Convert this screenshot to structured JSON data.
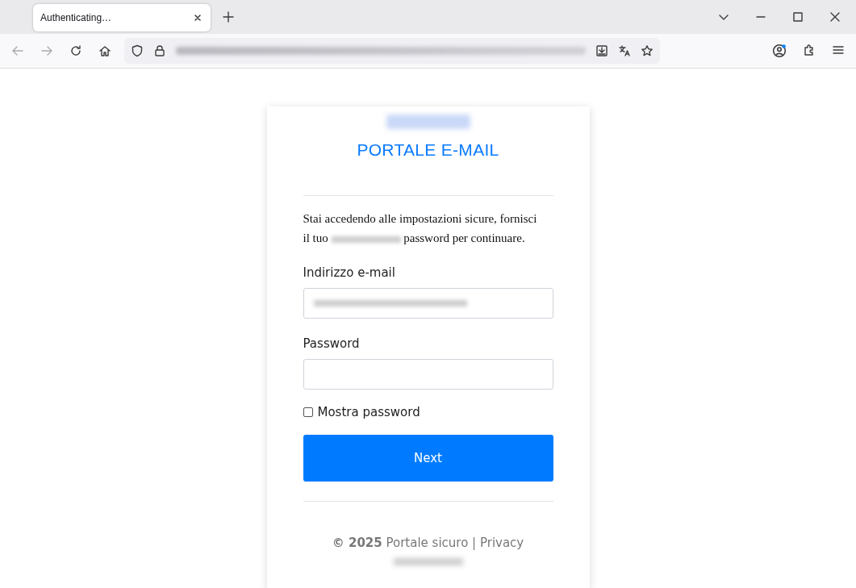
{
  "browser": {
    "tabs": [
      {
        "label": "Authenticating…",
        "selected": true
      }
    ],
    "address_redacted": true
  },
  "card": {
    "logo_redacted": true,
    "title": "PORTALE E-MAIL",
    "intro_before": "Stai accedendo alle impostazioni sicure, fornisci il tuo",
    "intro_after": "password per continuare.",
    "fields": [
      {
        "label": "Indirizzo e-mail",
        "redacted": true
      },
      {
        "label": "Password",
        "redacted": false
      }
    ],
    "show_password": {
      "label": "Mostra password",
      "checked": false
    },
    "button": "Next",
    "footer": {
      "year": "© 2025",
      "text": "Portale sicuro |",
      "link": "Privacy",
      "domain_redacted": true
    }
  }
}
